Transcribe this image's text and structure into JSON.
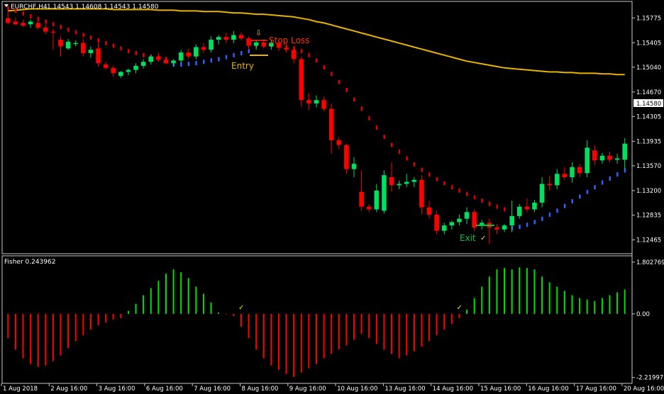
{
  "main_panel": {
    "symbol_label": "EURCHF,H4",
    "ohlc_label": "1.14543 1.14608 1.14543 1.14580",
    "current_price": "1.14580",
    "annotations": {
      "stop_loss": "Stop Loss",
      "entry": "Entry",
      "exit": "Exit",
      "arrow_glyph": "⇩",
      "check_glyph": "✓"
    },
    "colors": {
      "bull": "#00e060",
      "bear": "#ff0000",
      "ma": "#e8b400",
      "dots_bear": "#e00000",
      "dots_bull": "#3060ff",
      "entry_line": "#e8b400",
      "stop_line": "#ff3000",
      "exit_line": "#00c040"
    }
  },
  "sub_panel": {
    "indicator_label": "Fisher 0.243962",
    "colors": {
      "positive": "#00e000",
      "negative": "#ff0000"
    }
  },
  "x_axis": {
    "tick_labels": [
      "1 Aug 2018",
      "2 Aug 16:00",
      "3 Aug 16:00",
      "6 Aug 16:00",
      "7 Aug 16:00",
      "8 Aug 16:00",
      "9 Aug 16:00",
      "10 Aug 16:00",
      "13 Aug 16:00",
      "14 Aug 16:00",
      "15 Aug 16:00",
      "16 Aug 16:00",
      "17 Aug 16:00",
      "20 Aug 16:00"
    ]
  },
  "chart_data": [
    {
      "type": "candlestick",
      "title": "EURCHF,H4",
      "ylim": [
        1.1228,
        1.16
      ],
      "y_tick_labels": [
        "1.15775",
        "1.15405",
        "1.15040",
        "1.14670",
        "1.14305",
        "1.13935",
        "1.13570",
        "1.13200",
        "1.12835",
        "1.12465"
      ],
      "candles": [
        {
          "o": 1.1577,
          "h": 1.159,
          "l": 1.1568,
          "c": 1.157
        },
        {
          "o": 1.1572,
          "h": 1.1578,
          "l": 1.1566,
          "c": 1.1568
        },
        {
          "o": 1.157,
          "h": 1.1575,
          "l": 1.1564,
          "c": 1.1566
        },
        {
          "o": 1.1568,
          "h": 1.1575,
          "l": 1.1563,
          "c": 1.1572
        },
        {
          "o": 1.157,
          "h": 1.1574,
          "l": 1.156,
          "c": 1.1563
        },
        {
          "o": 1.1563,
          "h": 1.1568,
          "l": 1.1553,
          "c": 1.1557
        },
        {
          "o": 1.1557,
          "h": 1.1561,
          "l": 1.153,
          "c": 1.1556
        },
        {
          "o": 1.1545,
          "h": 1.155,
          "l": 1.152,
          "c": 1.1535
        },
        {
          "o": 1.1532,
          "h": 1.1546,
          "l": 1.153,
          "c": 1.1542
        },
        {
          "o": 1.154,
          "h": 1.1544,
          "l": 1.1535,
          "c": 1.154
        },
        {
          "o": 1.154,
          "h": 1.1546,
          "l": 1.152,
          "c": 1.1525
        },
        {
          "o": 1.1525,
          "h": 1.1535,
          "l": 1.1518,
          "c": 1.153
        },
        {
          "o": 1.1532,
          "h": 1.154,
          "l": 1.1505,
          "c": 1.151
        },
        {
          "o": 1.1508,
          "h": 1.1512,
          "l": 1.15,
          "c": 1.1503
        },
        {
          "o": 1.1503,
          "h": 1.1506,
          "l": 1.149,
          "c": 1.1495
        },
        {
          "o": 1.1491,
          "h": 1.1498,
          "l": 1.1488,
          "c": 1.1497
        },
        {
          "o": 1.1497,
          "h": 1.1502,
          "l": 1.1492,
          "c": 1.15
        },
        {
          "o": 1.15,
          "h": 1.151,
          "l": 1.1495,
          "c": 1.1506
        },
        {
          "o": 1.1506,
          "h": 1.1516,
          "l": 1.1502,
          "c": 1.1512
        },
        {
          "o": 1.1512,
          "h": 1.1522,
          "l": 1.1508,
          "c": 1.152
        },
        {
          "o": 1.152,
          "h": 1.1525,
          "l": 1.1512,
          "c": 1.1515
        },
        {
          "o": 1.1515,
          "h": 1.152,
          "l": 1.1508,
          "c": 1.151
        },
        {
          "o": 1.151,
          "h": 1.1516,
          "l": 1.1506,
          "c": 1.1514
        },
        {
          "o": 1.1514,
          "h": 1.153,
          "l": 1.151,
          "c": 1.1526
        },
        {
          "o": 1.1526,
          "h": 1.1532,
          "l": 1.1516,
          "c": 1.152
        },
        {
          "o": 1.152,
          "h": 1.1538,
          "l": 1.1516,
          "c": 1.1534
        },
        {
          "o": 1.1534,
          "h": 1.154,
          "l": 1.1525,
          "c": 1.153
        },
        {
          "o": 1.153,
          "h": 1.155,
          "l": 1.1526,
          "c": 1.1545
        },
        {
          "o": 1.1545,
          "h": 1.1552,
          "l": 1.1538,
          "c": 1.1549
        },
        {
          "o": 1.1549,
          "h": 1.1555,
          "l": 1.154,
          "c": 1.1545
        },
        {
          "o": 1.1545,
          "h": 1.1558,
          "l": 1.154,
          "c": 1.1552
        },
        {
          "o": 1.1552,
          "h": 1.1556,
          "l": 1.1544,
          "c": 1.1547
        },
        {
          "o": 1.1547,
          "h": 1.155,
          "l": 1.153,
          "c": 1.1536
        },
        {
          "o": 1.1536,
          "h": 1.1545,
          "l": 1.153,
          "c": 1.1541
        },
        {
          "o": 1.1541,
          "h": 1.1546,
          "l": 1.1532,
          "c": 1.1535
        },
        {
          "o": 1.1535,
          "h": 1.1545,
          "l": 1.153,
          "c": 1.154
        },
        {
          "o": 1.154,
          "h": 1.1545,
          "l": 1.1528,
          "c": 1.1533
        },
        {
          "o": 1.1533,
          "h": 1.154,
          "l": 1.1526,
          "c": 1.153
        },
        {
          "o": 1.153,
          "h": 1.1534,
          "l": 1.151,
          "c": 1.1516
        },
        {
          "o": 1.1516,
          "h": 1.152,
          "l": 1.1445,
          "c": 1.1455
        },
        {
          "o": 1.1455,
          "h": 1.1465,
          "l": 1.144,
          "c": 1.145
        },
        {
          "o": 1.145,
          "h": 1.1462,
          "l": 1.1444,
          "c": 1.1455
        },
        {
          "o": 1.1455,
          "h": 1.146,
          "l": 1.1438,
          "c": 1.1442
        },
        {
          "o": 1.1442,
          "h": 1.145,
          "l": 1.1375,
          "c": 1.1395
        },
        {
          "o": 1.1395,
          "h": 1.14,
          "l": 1.1382,
          "c": 1.1388
        },
        {
          "o": 1.1388,
          "h": 1.139,
          "l": 1.1345,
          "c": 1.1352
        },
        {
          "o": 1.1352,
          "h": 1.137,
          "l": 1.134,
          "c": 1.136
        },
        {
          "o": 1.1318,
          "h": 1.135,
          "l": 1.129,
          "c": 1.1296
        },
        {
          "o": 1.1296,
          "h": 1.13,
          "l": 1.1288,
          "c": 1.1292
        },
        {
          "o": 1.1292,
          "h": 1.133,
          "l": 1.1288,
          "c": 1.132
        },
        {
          "o": 1.129,
          "h": 1.135,
          "l": 1.1286,
          "c": 1.1343
        },
        {
          "o": 1.134,
          "h": 1.1362,
          "l": 1.1318,
          "c": 1.1328
        },
        {
          "o": 1.1328,
          "h": 1.1335,
          "l": 1.1322,
          "c": 1.133
        },
        {
          "o": 1.133,
          "h": 1.1345,
          "l": 1.1325,
          "c": 1.1333
        },
        {
          "o": 1.1333,
          "h": 1.134,
          "l": 1.1325,
          "c": 1.1336
        },
        {
          "o": 1.1336,
          "h": 1.1343,
          "l": 1.1285,
          "c": 1.1295
        },
        {
          "o": 1.1295,
          "h": 1.1305,
          "l": 1.1278,
          "c": 1.1284
        },
        {
          "o": 1.1284,
          "h": 1.129,
          "l": 1.1255,
          "c": 1.126
        },
        {
          "o": 1.126,
          "h": 1.1272,
          "l": 1.1255,
          "c": 1.1268
        },
        {
          "o": 1.1268,
          "h": 1.1275,
          "l": 1.1262,
          "c": 1.1273
        },
        {
          "o": 1.1273,
          "h": 1.1284,
          "l": 1.1268,
          "c": 1.1278
        },
        {
          "o": 1.1278,
          "h": 1.1295,
          "l": 1.127,
          "c": 1.1288
        },
        {
          "o": 1.1288,
          "h": 1.1292,
          "l": 1.126,
          "c": 1.1265
        },
        {
          "o": 1.1268,
          "h": 1.1276,
          "l": 1.1262,
          "c": 1.1272
        },
        {
          "o": 1.1272,
          "h": 1.1278,
          "l": 1.124,
          "c": 1.1265
        },
        {
          "o": 1.1265,
          "h": 1.127,
          "l": 1.1255,
          "c": 1.1262
        },
        {
          "o": 1.1262,
          "h": 1.127,
          "l": 1.1258,
          "c": 1.1268
        },
        {
          "o": 1.1268,
          "h": 1.1305,
          "l": 1.1258,
          "c": 1.1282
        },
        {
          "o": 1.1282,
          "h": 1.13,
          "l": 1.1278,
          "c": 1.1296
        },
        {
          "o": 1.1296,
          "h": 1.1308,
          "l": 1.1288,
          "c": 1.1292
        },
        {
          "o": 1.1292,
          "h": 1.1306,
          "l": 1.1288,
          "c": 1.1302
        },
        {
          "o": 1.1302,
          "h": 1.134,
          "l": 1.1295,
          "c": 1.133
        },
        {
          "o": 1.133,
          "h": 1.1342,
          "l": 1.132,
          "c": 1.1328
        },
        {
          "o": 1.1328,
          "h": 1.1352,
          "l": 1.1322,
          "c": 1.1345
        },
        {
          "o": 1.1345,
          "h": 1.1355,
          "l": 1.1336,
          "c": 1.134
        },
        {
          "o": 1.134,
          "h": 1.1362,
          "l": 1.1332,
          "c": 1.1355
        },
        {
          "o": 1.1355,
          "h": 1.136,
          "l": 1.134,
          "c": 1.1346
        },
        {
          "o": 1.1346,
          "h": 1.1395,
          "l": 1.134,
          "c": 1.1384
        },
        {
          "o": 1.138,
          "h": 1.1388,
          "l": 1.1358,
          "c": 1.1365
        },
        {
          "o": 1.1365,
          "h": 1.1376,
          "l": 1.136,
          "c": 1.1372
        },
        {
          "o": 1.1372,
          "h": 1.1378,
          "l": 1.1362,
          "c": 1.1366
        },
        {
          "o": 1.1366,
          "h": 1.1375,
          "l": 1.136,
          "c": 1.1368
        },
        {
          "o": 1.1366,
          "h": 1.1398,
          "l": 1.1352,
          "c": 1.139
        }
      ],
      "moving_average": [
        1.1588,
        1.1589,
        1.159,
        1.1591,
        1.1591,
        1.1591,
        1.1591,
        1.1591,
        1.1591,
        1.1591,
        1.1591,
        1.1591,
        1.1591,
        1.1591,
        1.159,
        1.159,
        1.159,
        1.159,
        1.159,
        1.159,
        1.1589,
        1.1589,
        1.1589,
        1.1588,
        1.1588,
        1.1588,
        1.1587,
        1.1587,
        1.1587,
        1.1586,
        1.1585,
        1.1585,
        1.1584,
        1.1583,
        1.1583,
        1.1582,
        1.1581,
        1.158,
        1.1579,
        1.1577,
        1.1575,
        1.1572,
        1.157,
        1.1567,
        1.1564,
        1.1561,
        1.1558,
        1.1555,
        1.1552,
        1.1549,
        1.1546,
        1.1543,
        1.154,
        1.1537,
        1.1534,
        1.1531,
        1.1528,
        1.1525,
        1.1522,
        1.1519,
        1.1516,
        1.1513,
        1.1511,
        1.1509,
        1.1507,
        1.1505,
        1.1503,
        1.1502,
        1.1501,
        1.15,
        1.1499,
        1.1498,
        1.1497,
        1.1497,
        1.1496,
        1.1496,
        1.1495,
        1.1495,
        1.1495,
        1.1494,
        1.1494,
        1.1493,
        1.1493
      ],
      "dots_bear": [
        1.1592,
        1.1588,
        1.1584,
        1.158,
        1.1576,
        1.1572,
        1.1568,
        1.1564,
        1.156,
        1.1556,
        1.1552,
        1.1548,
        1.1544,
        1.154,
        1.1536,
        1.1532,
        1.1528,
        1.1525,
        1.1522,
        1.152,
        1.1518,
        1.1516,
        null,
        null,
        null,
        null,
        null,
        null,
        null,
        null,
        null,
        null,
        null,
        1.1536,
        1.1537,
        1.1537,
        1.1536,
        1.1534,
        1.1532,
        1.1528,
        1.1522,
        1.1514,
        1.1504,
        1.1494,
        1.1482,
        1.147,
        1.1456,
        1.1442,
        1.1428,
        1.1414,
        1.14,
        1.1388,
        1.1378,
        1.1368,
        1.1359,
        1.1351,
        1.1344,
        1.1337,
        1.1331,
        1.1325,
        1.132,
        1.1315,
        1.131,
        1.1305,
        1.13,
        1.1296,
        1.1292,
        null,
        null,
        null,
        null,
        null,
        null,
        null,
        null,
        null,
        null,
        null,
        null,
        null,
        null,
        null,
        null
      ],
      "dots_bull": [
        null,
        null,
        null,
        null,
        null,
        null,
        null,
        null,
        null,
        null,
        null,
        null,
        null,
        null,
        null,
        null,
        null,
        null,
        null,
        null,
        null,
        null,
        1.1508,
        1.1508,
        1.1509,
        1.151,
        1.1512,
        1.1514,
        1.1516,
        1.1519,
        1.1522,
        1.1525,
        1.1528,
        null,
        null,
        null,
        null,
        null,
        null,
        null,
        null,
        null,
        null,
        null,
        null,
        null,
        null,
        null,
        null,
        null,
        null,
        null,
        null,
        null,
        null,
        null,
        null,
        null,
        null,
        null,
        null,
        null,
        null,
        null,
        null,
        null,
        null,
        1.1264,
        1.1266,
        1.1269,
        1.1273,
        1.1278,
        1.1284,
        1.129,
        1.1297,
        1.1304,
        1.1311,
        1.1318,
        1.1325,
        1.1332,
        1.1338,
        1.1344,
        1.135
      ],
      "levels": {
        "stop_loss": 1.1553,
        "entry": 1.1528,
        "exit": 1.1268
      }
    },
    {
      "type": "bar",
      "title": "Fisher 0.243962",
      "ylim": [
        -2.35,
        1.95
      ],
      "y_tick_labels": [
        "1.802769",
        "0.00",
        "-2.219977"
      ],
      "values": [
        -0.85,
        -1.25,
        -1.55,
        -1.75,
        -1.85,
        -1.8,
        -1.65,
        -1.45,
        -1.2,
        -0.95,
        -0.75,
        -0.55,
        -0.4,
        -0.3,
        -0.2,
        -0.15,
        0.1,
        0.35,
        0.65,
        0.9,
        1.15,
        1.4,
        1.55,
        1.45,
        1.25,
        0.95,
        0.7,
        0.4,
        0.05,
        -0.02,
        -0.08,
        -0.45,
        -0.85,
        -1.25,
        -1.55,
        -1.8,
        -1.95,
        -2.1,
        -2.2,
        -2.05,
        -1.9,
        -1.75,
        -1.55,
        -1.4,
        -1.25,
        -1.1,
        -0.9,
        -0.7,
        -0.85,
        -1.05,
        -1.25,
        -1.4,
        -1.55,
        -1.45,
        -1.3,
        -1.15,
        -0.95,
        -0.75,
        -0.55,
        -0.35,
        -0.15,
        0.15,
        0.55,
        0.95,
        1.3,
        1.55,
        1.6,
        1.55,
        1.62,
        1.6,
        1.55,
        1.3,
        1.1,
        0.95,
        0.8,
        0.65,
        0.55,
        0.5,
        0.45,
        0.55,
        0.65,
        0.75,
        0.85
      ],
      "signals": [
        {
          "bar_index": 31,
          "glyph": "✓"
        },
        {
          "bar_index": 60,
          "glyph": "✓"
        }
      ]
    }
  ]
}
